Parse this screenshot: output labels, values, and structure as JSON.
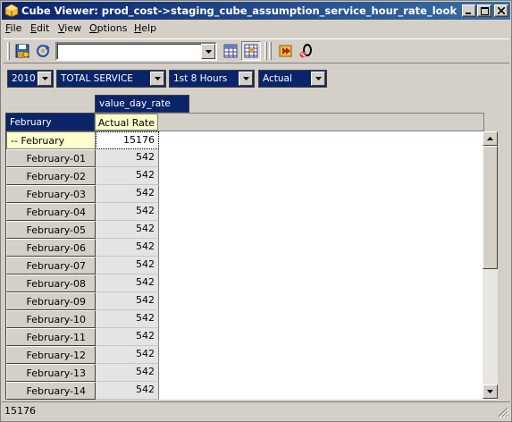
{
  "window": {
    "title": "Cube Viewer: prod_cost->staging_cube_assumption_service_hour_rate_lookup_date..."
  },
  "menu": [
    {
      "label": "File",
      "accel": "F",
      "rest": "ile"
    },
    {
      "label": "Edit",
      "accel": "E",
      "rest": "dit"
    },
    {
      "label": "View",
      "accel": "V",
      "rest": "iew"
    },
    {
      "label": "Options",
      "accel": "O",
      "rest": "ptions"
    },
    {
      "label": "Help",
      "accel": "H",
      "rest": "elp"
    }
  ],
  "toolbar": {
    "view_combo_value": ""
  },
  "dimensions": [
    {
      "value": "2010"
    },
    {
      "value": "TOTAL SERVICE"
    },
    {
      "value": "1st 8 Hours"
    },
    {
      "value": "Actual"
    }
  ],
  "grid": {
    "column_dimension": "value_day_rate",
    "row_dimension": "February",
    "column_header": "Actual Rate",
    "rows": [
      {
        "label": "-- February",
        "value": "15176"
      },
      {
        "label": "February-01",
        "value": "542"
      },
      {
        "label": "February-02",
        "value": "542"
      },
      {
        "label": "February-03",
        "value": "542"
      },
      {
        "label": "February-04",
        "value": "542"
      },
      {
        "label": "February-05",
        "value": "542"
      },
      {
        "label": "February-06",
        "value": "542"
      },
      {
        "label": "February-07",
        "value": "542"
      },
      {
        "label": "February-08",
        "value": "542"
      },
      {
        "label": "February-09",
        "value": "542"
      },
      {
        "label": "February-10",
        "value": "542"
      },
      {
        "label": "February-11",
        "value": "542"
      },
      {
        "label": "February-12",
        "value": "542"
      },
      {
        "label": "February-13",
        "value": "542"
      },
      {
        "label": "February-14",
        "value": "542"
      }
    ]
  },
  "status": {
    "text": "15176"
  },
  "colors": {
    "title_start": "#0a246a",
    "title_end": "#3a6ea5",
    "face": "#d4d0c8",
    "header_highlight": "#ffffcc"
  }
}
